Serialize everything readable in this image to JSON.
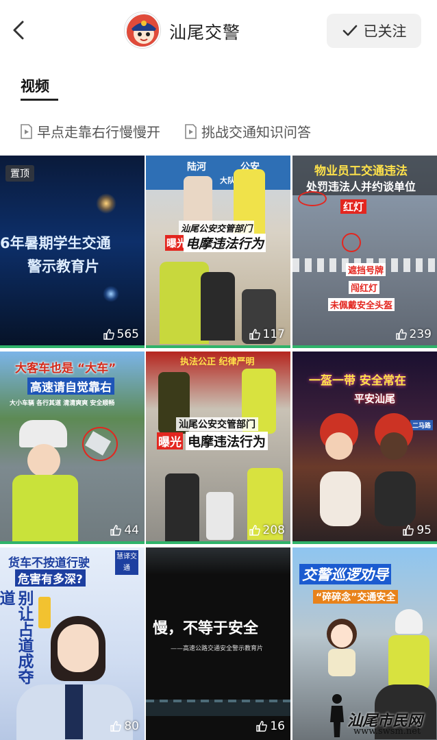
{
  "header": {
    "title": "汕尾交警",
    "follow_label": "已关注"
  },
  "tabs": [
    {
      "label": "视频"
    }
  ],
  "collections": [
    {
      "label": "早点走靠右行慢慢开"
    },
    {
      "label": "挑战交通知识问答"
    }
  ],
  "videos": [
    {
      "pinned_label": "置顶",
      "caption1": "6年暑期学生交通 ",
      "caption2": "警示教育片",
      "likes": "565"
    },
    {
      "caption1": "汕尾公安交管部门",
      "caption_tag": "曝光",
      "caption2": "电摩违法行为",
      "sign1": "陆河",
      "sign2": "公安",
      "sign3": "大队",
      "likes": "117"
    },
    {
      "caption1": "物业员工交通违法",
      "caption2": "处罚违法人并约谈单位",
      "tag1": "红灯",
      "tag2": "遮挡号牌",
      "tag3": "闯红灯",
      "tag4": "未佩戴安全头盔",
      "likes": "239"
    },
    {
      "caption1": "大客车也是 “大车”",
      "caption2": "高速请自觉靠右",
      "caption3": "大小车辆  各行其道  清清爽爽  安全顺畅",
      "likes": "44"
    },
    {
      "banner": "执法公正  纪律严明",
      "caption1": "汕尾公安交管部门",
      "caption_tag": "曝光",
      "caption2": "电摩违法行为",
      "likes": "208"
    },
    {
      "caption1": "一盔一带 安全常在",
      "caption2": "平安汕尾",
      "sign": "二马路",
      "likes": "95"
    },
    {
      "caption1": "货车不按道行驶",
      "caption2": "危害有多深?",
      "caption3": "别让占道成夺道",
      "badge": "慧译交通",
      "likes": "80"
    },
    {
      "caption1": "慢，不等于安全",
      "caption2": "——高速公路交通安全警示教育片",
      "likes": "16"
    },
    {
      "caption1": "交警巡逻劝导",
      "caption2": "“碎碎念”交通安全",
      "likes": ""
    }
  ],
  "watermark": {
    "text": "汕尾市民网",
    "url": "www.swsm.net"
  },
  "colors": {
    "accent_green": "#2fb36a",
    "follow_bg": "#f1f1f1"
  }
}
